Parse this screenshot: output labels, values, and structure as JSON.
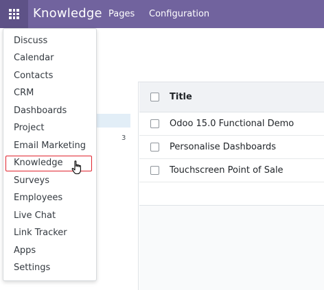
{
  "navbar": {
    "brand": "Knowledge",
    "menu": [
      "Pages",
      "Configuration"
    ],
    "apps_icon": "grid-icon",
    "bg_color": "#71639e"
  },
  "apps_menu": {
    "items": [
      "Discuss",
      "Calendar",
      "Contacts",
      "CRM",
      "Dashboards",
      "Project",
      "Email Marketing",
      "Knowledge",
      "Surveys",
      "Employees",
      "Live Chat",
      "Link Tracker",
      "Apps",
      "Settings"
    ],
    "highlighted": "Knowledge",
    "highlight_color": "#e0212b"
  },
  "sidebar": {
    "count": "3"
  },
  "list": {
    "column_title": "Title",
    "rows": [
      "Odoo 15.0 Functional Demo",
      "Personalise Dashboards",
      "Touchscreen Point of Sale"
    ]
  }
}
